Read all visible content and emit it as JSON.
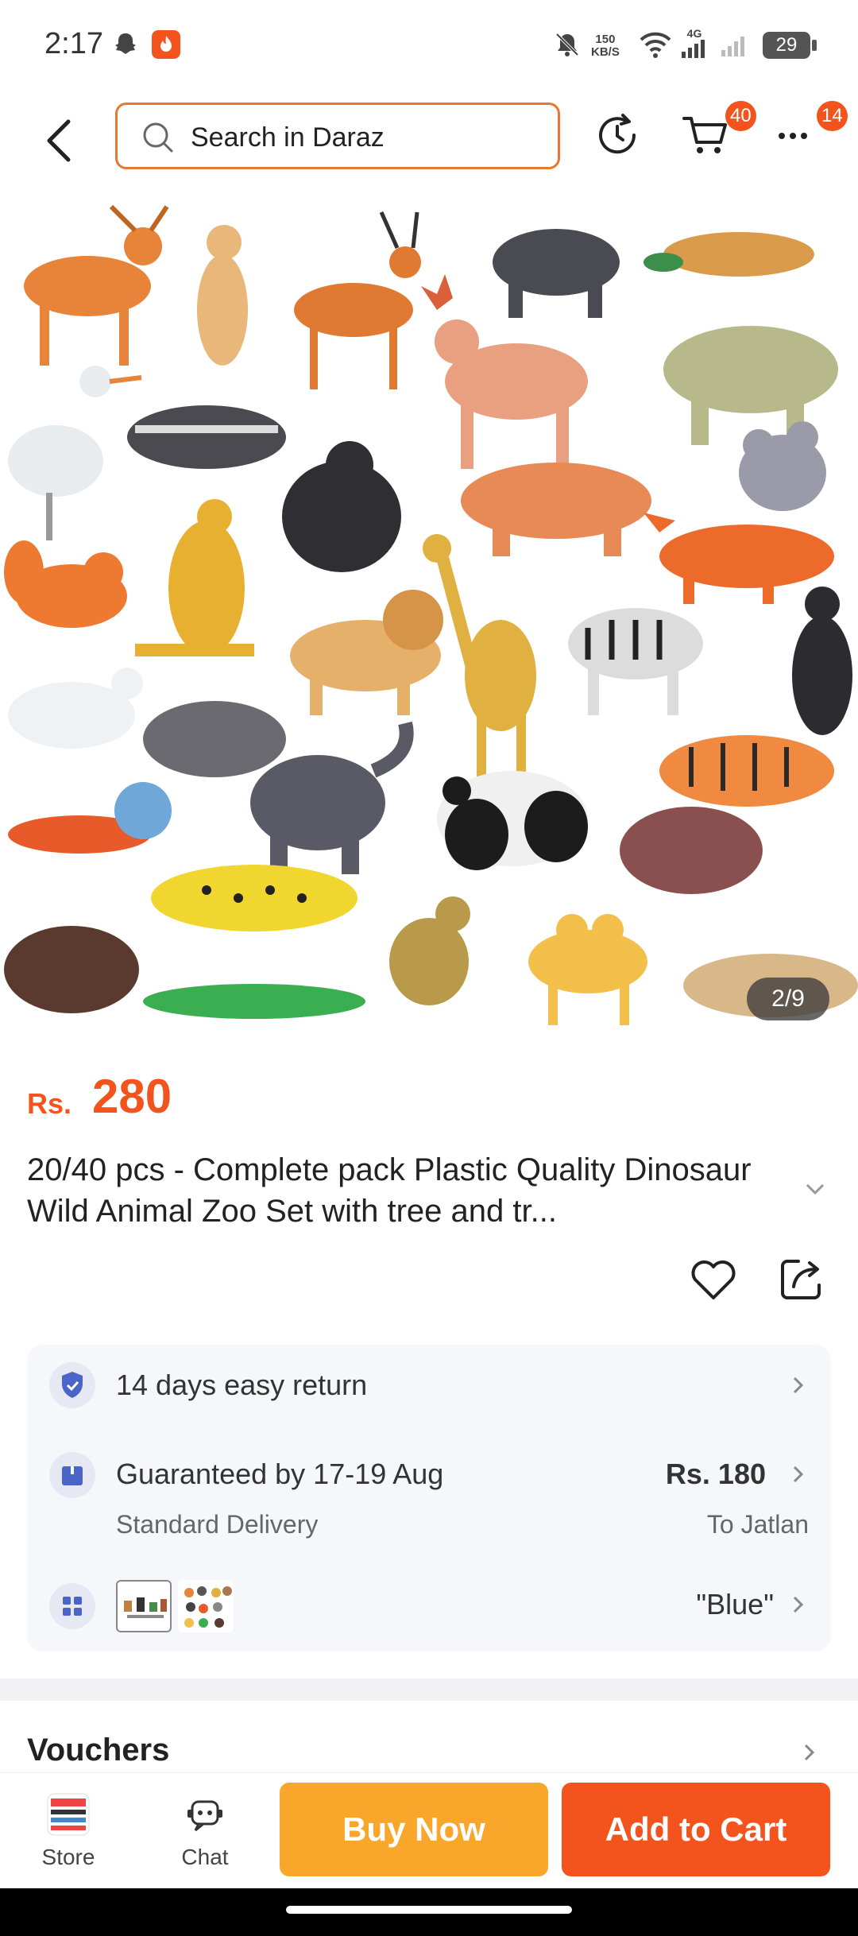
{
  "status_bar": {
    "time": "2:17",
    "net_speed_value": "150",
    "net_speed_unit": "KB/S",
    "network_type": "4G",
    "battery": "29"
  },
  "header": {
    "search_placeholder": "Search in Daraz",
    "cart_count": "40",
    "more_count": "14"
  },
  "gallery": {
    "counter": "2/9"
  },
  "product": {
    "currency": "Rs.",
    "price": "280",
    "title": "20/40 pcs - Complete pack Plastic Quality Dinosaur Wild Animal Zoo Set with tree and tr..."
  },
  "info": {
    "return_policy": "14 days easy return",
    "delivery_title": "Guaranteed by 17-19 Aug",
    "delivery_type": "Standard Delivery",
    "delivery_fee": "Rs. 180",
    "delivery_location": "To Jatlan",
    "variant_value": "\"Blue\""
  },
  "sections": {
    "vouchers": "Vouchers"
  },
  "bottom_bar": {
    "store_label": "Store",
    "chat_label": "Chat",
    "buy_now_label": "Buy Now",
    "add_to_cart_label": "Add to Cart"
  },
  "colors": {
    "accent": "#f3541e",
    "buy_now": "#f9a72b",
    "add_to_cart": "#f3541e",
    "search_border": "#e7782f"
  }
}
